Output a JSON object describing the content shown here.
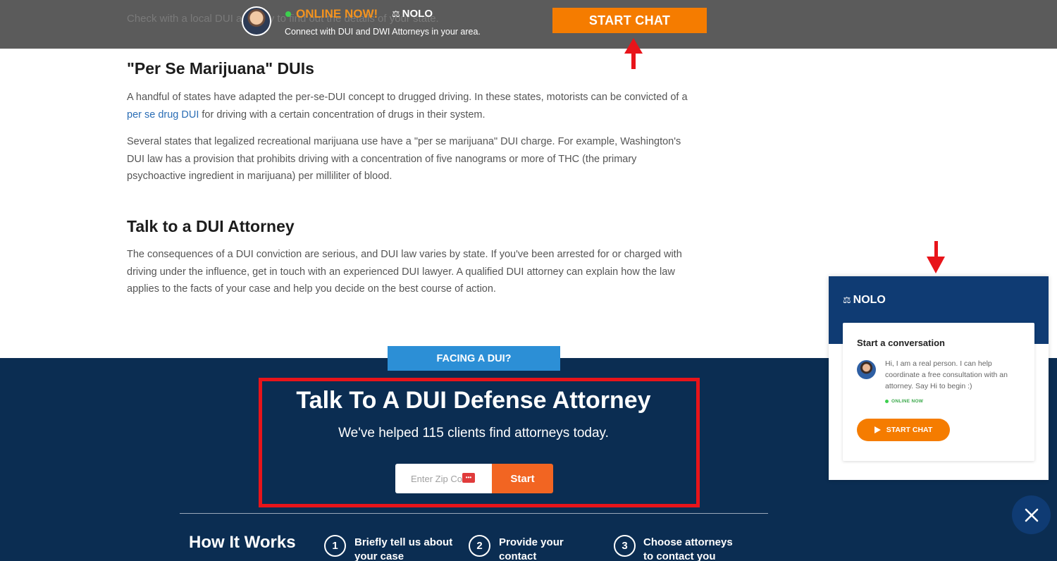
{
  "topbar": {
    "behind_text": "Check with a local DUI attorney to find out the details of your state.",
    "online_label": "ONLINE NOW!",
    "brand": "NOLO",
    "tagline": "Connect with DUI and DWI Attorneys in your area.",
    "start_chat_label": "START CHAT"
  },
  "article": {
    "section1": {
      "heading": "\"Per Se Marijuana\" DUIs",
      "p1_before": "A handful of states have adapted the per-se-DUI concept to drugged driving. In these states, motorists can be convicted of a ",
      "p1_link": "per se drug DUI",
      "p1_after": " for driving with a certain concentration of drugs in their system.",
      "p2": "Several states that legalized recreational marijuana use have a \"per se marijuana\" DUI charge. For example, Washington's DUI law has a provision that prohibits driving with a concentration of five nanograms or more of THC (the primary psychoactive ingredient in marijuana) per milliliter of blood."
    },
    "section2": {
      "heading": "Talk to a DUI Attorney",
      "p": "The consequences of a DUI conviction are serious, and DUI law varies by state. If you've been arrested for or charged with driving under the influence, get in touch with an experienced DUI lawyer. A qualified DUI attorney can explain how the law applies to the facts of your case and help you decide on the best course of action."
    }
  },
  "cta": {
    "tab_label": "FACING A DUI?",
    "title": "Talk To A DUI Defense Attorney",
    "subtitle": "We've helped 115 clients find attorneys today.",
    "zip_placeholder": "Enter Zip Code",
    "start_label": "Start",
    "how_title": "How It Works",
    "steps": [
      {
        "num": "1",
        "text": "Briefly tell us about your case"
      },
      {
        "num": "2",
        "text": "Provide your contact"
      },
      {
        "num": "3",
        "text": "Choose attorneys to contact you"
      }
    ]
  },
  "chat_widget": {
    "brand": "NOLO",
    "card_title": "Start a conversation",
    "agent_message": "Hi, I am a real person. I can help coordinate a free consultation with an attorney. Say Hi to begin :)",
    "online_status": "ONLINE NOW",
    "start_chat_label": "START CHAT"
  },
  "colors": {
    "topbar_bg": "#5b5b5b",
    "orange": "#f57c00",
    "cta_bg": "#0b2d52",
    "tab_blue": "#2c8fd6",
    "annotation_red": "#e8141a"
  },
  "icons": [
    "attorney-avatar",
    "scale-icon",
    "send-icon",
    "close-icon",
    "arrow-annotation"
  ]
}
